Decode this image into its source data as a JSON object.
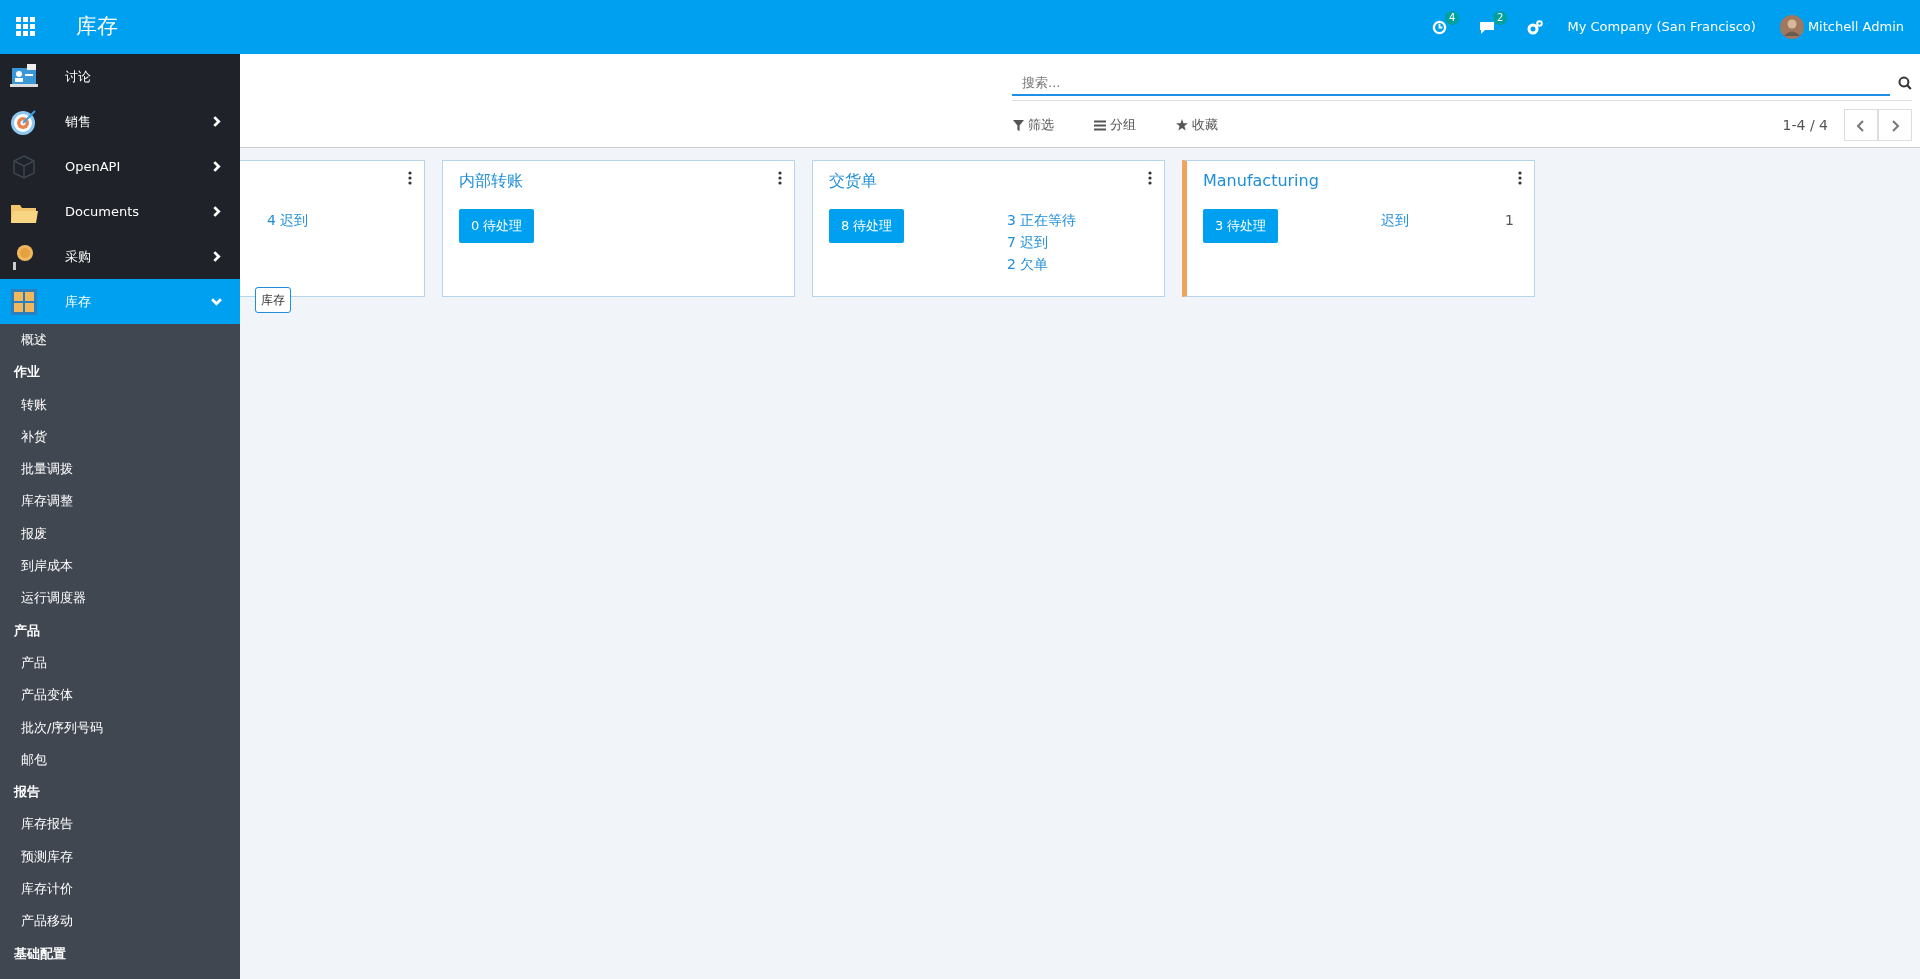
{
  "topbar": {
    "title": "库存",
    "activity_count": "4",
    "message_count": "2",
    "company": "My Company (San Francisco)",
    "user": "Mitchell Admin"
  },
  "sidebar": {
    "apps": [
      {
        "label": "讨论",
        "selected": false
      },
      {
        "label": "销售",
        "selected": false,
        "expanded": false
      },
      {
        "label": "OpenAPI",
        "selected": false,
        "expanded": false
      },
      {
        "label": "Documents",
        "selected": false,
        "expanded": false
      },
      {
        "label": "采购",
        "selected": false,
        "expanded": false
      },
      {
        "label": "库存",
        "selected": true,
        "expanded": true,
        "tooltip": "库存",
        "children": [
          {
            "label": "概述"
          },
          {
            "label": "作业",
            "children": [
              {
                "label": "转账"
              },
              {
                "label": "补货"
              },
              {
                "label": "批量调拨"
              },
              {
                "label": "库存调整"
              },
              {
                "label": "报废"
              },
              {
                "label": "到岸成本"
              },
              {
                "label": "运行调度器"
              }
            ]
          },
          {
            "label": "产品",
            "children": [
              {
                "label": "产品"
              },
              {
                "label": "产品变体"
              },
              {
                "label": "批次/序列号码"
              },
              {
                "label": "邮包"
              }
            ]
          },
          {
            "label": "报告",
            "children": [
              {
                "label": "库存报告"
              },
              {
                "label": "预测库存"
              },
              {
                "label": "库存计价"
              },
              {
                "label": "产品移动"
              }
            ]
          },
          {
            "label": "基础配置"
          }
        ]
      }
    ]
  },
  "control_panel": {
    "search": {
      "placeholder": "搜索..."
    },
    "filters": [
      "筛选",
      "分组",
      "收藏"
    ],
    "pager": "1-4 / 4"
  },
  "cards": [
    {
      "stats": [
        {
          "label": "4 迟到"
        }
      ]
    },
    {
      "title": "内部转账",
      "button": "0 待处理"
    },
    {
      "title": "交货单",
      "button": "8 待处理",
      "stats": [
        {
          "label": "3 正在等待"
        },
        {
          "label": "7 迟到"
        },
        {
          "label": "2 欠单"
        }
      ]
    },
    {
      "title": "Manufacturing",
      "color": "#f0a35e",
      "button": "3 待处理",
      "stats": [
        {
          "label": "迟到",
          "count": "1"
        }
      ]
    }
  ]
}
